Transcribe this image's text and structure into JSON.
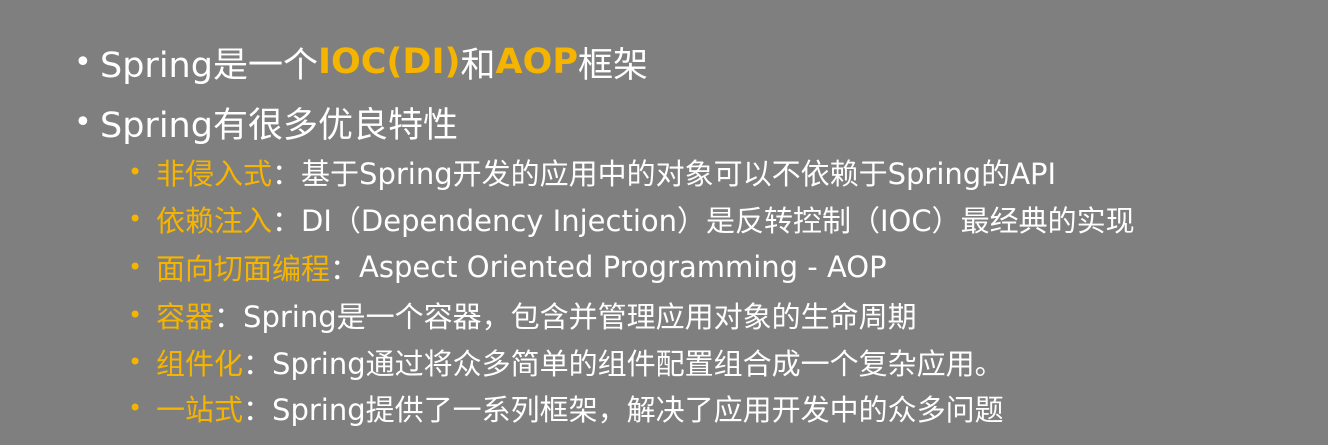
{
  "bullets": [
    {
      "parts": [
        "Spring是一个 ",
        "IOC(DI)",
        " 和 ",
        "AOP",
        " 框架"
      ]
    },
    {
      "text": "Spring有很多优良特性"
    }
  ],
  "features": [
    {
      "term": "非侵入式",
      "sep": "：",
      "desc": "基于Spring开发的应用中的对象可以不依赖于Spring的API"
    },
    {
      "term": "依赖注入",
      "sep": "：",
      "desc": "DI（Dependency Injection）是反转控制（IOC）最经典的实现"
    },
    {
      "term": "面向切面编程",
      "sep": "：",
      "desc": " Aspect Oriented Programming - AOP"
    },
    {
      "term": "容器",
      "sep": "：",
      "desc": "Spring是一个容器，包含并管理应用对象的生命周期"
    },
    {
      "term": "组件化",
      "sep": "：",
      "desc": "Spring通过将众多简单的组件配置组合成一个复杂应用。"
    },
    {
      "term": "一站式",
      "sep": "：",
      "desc": "Spring提供了一系列框架，解决了应用开发中的众多问题"
    }
  ],
  "glyphs": {
    "bullet": "•"
  },
  "colors": {
    "background": "#7f7f7f",
    "accent": "#f5b400",
    "text": "#ffffff"
  }
}
